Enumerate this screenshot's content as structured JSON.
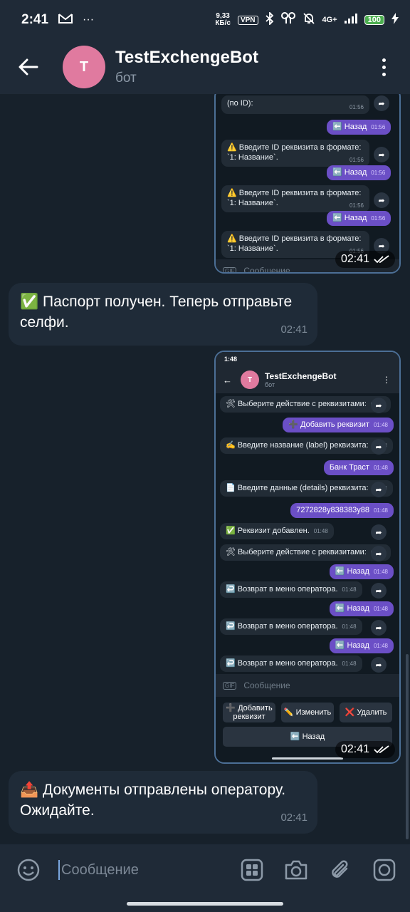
{
  "status_bar": {
    "time": "2:41",
    "speed_top": "9,33",
    "speed_bottom": "КБ/с",
    "vpn": "VPN",
    "network": "4G+",
    "battery": "100"
  },
  "header": {
    "avatar_letter": "T",
    "title": "TestExchengeBot",
    "subtitle": "бот"
  },
  "chat": {
    "screenshot1": {
      "partial_top": "(по ID):",
      "partial_top_time": "01:56",
      "back_label": "⬅️ Назад",
      "back_time": "01:56",
      "prompt": "⚠️ Введите ID реквизита в формате: `1: Название`.",
      "prompt_time": "01:56",
      "input_placeholder": "Сообщение",
      "gif": "GIF",
      "overlay_time": "02:41"
    },
    "msg_passport": {
      "text": "✅ Паспорт получен. Теперь отправьте селфи.",
      "time": "02:41"
    },
    "screenshot2": {
      "time": "1:48",
      "title": "TestExchengeBot",
      "subtitle": "бот",
      "avatar_letter": "T",
      "messages": [
        {
          "dir": "in",
          "text": "🛠 Выберите действие с реквизитами:",
          "time": "01:48"
        },
        {
          "dir": "out",
          "text": "➕ Добавить реквизит",
          "time": "01:48"
        },
        {
          "dir": "in",
          "text": "✍️ Введите название (label) реквизита:",
          "time": "01:48"
        },
        {
          "dir": "out",
          "text": "Банк Траст",
          "time": "01:48"
        },
        {
          "dir": "in",
          "text": "📄 Введите данные (details) реквизита:",
          "time": "01:48"
        },
        {
          "dir": "out",
          "text": "7272828y838383y88",
          "time": "01:48"
        },
        {
          "dir": "in",
          "text": "✅ Реквизит добавлен.",
          "time": "01:48"
        },
        {
          "dir": "in",
          "text": "🛠 Выберите действие с реквизитами:",
          "time": "01:48"
        },
        {
          "dir": "out",
          "text": "⬅️ Назад",
          "time": "01:48"
        },
        {
          "dir": "in",
          "text": "↩️ Возврат в меню оператора.",
          "time": "01:48"
        },
        {
          "dir": "out",
          "text": "⬅️ Назад",
          "time": "01:48"
        },
        {
          "dir": "in",
          "text": "↩️ Возврат в меню оператора.",
          "time": "01:48"
        },
        {
          "dir": "out",
          "text": "⬅️ Назад",
          "time": "01:48"
        },
        {
          "dir": "in",
          "text": "↩️ Возврат в меню оператора.",
          "time": "01:48"
        }
      ],
      "input_placeholder": "Сообщение",
      "gif": "GIF",
      "keyboard": {
        "add": "➕ Добавить реквизит",
        "edit": "✏️ Изменить",
        "delete": "❌ Удалить",
        "back": "⬅️ Назад"
      },
      "overlay_time": "02:41"
    },
    "msg_docs": {
      "text": "📤 Документы отправлены оператору. Ожидайте.",
      "time": "02:41"
    }
  },
  "input": {
    "placeholder": "Сообщение"
  },
  "colors": {
    "background": "#17212b",
    "bar": "#1f2a37",
    "incoming_bubble": "#1f2b38",
    "outgoing_bubble_mini": "#6b4fc6",
    "image_border": "#4c6f96",
    "avatar": "#e07a9f"
  }
}
